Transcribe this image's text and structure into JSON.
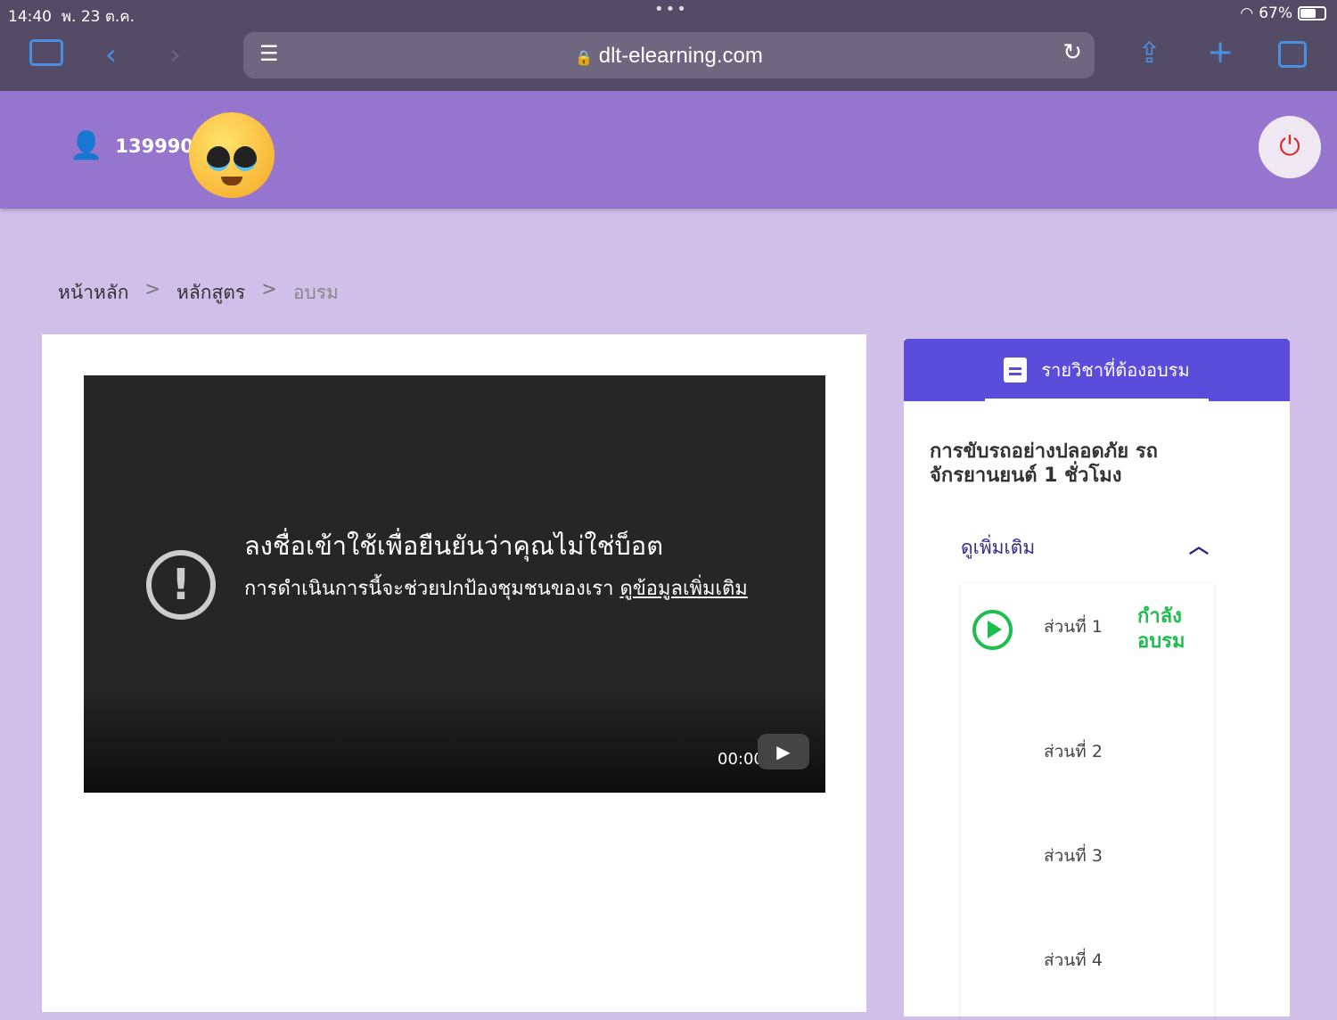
{
  "status_bar": {
    "time": "14:40",
    "date": "พ. 23 ต.ค.",
    "battery": "67%",
    "battery_level": 67
  },
  "browser": {
    "url": "dlt-elearning.com"
  },
  "header": {
    "user_id": "1399900"
  },
  "breadcrumb": {
    "items": [
      "หน้าหลัก",
      "หลักสูตร",
      "อบรม"
    ],
    "separator": ">"
  },
  "video": {
    "title": "ลงชื่อเข้าใช้เพื่อยืนยันว่าคุณไม่ใช่บ็อต",
    "subtitle": "การดำเนินการนี้จะช่วยปกป้องชุมชนของเรา",
    "link": "ดูข้อมูลเพิ่มเติม",
    "time": "00:00"
  },
  "sidebar": {
    "tab_label": "รายวิชาที่ต้องอบรม",
    "course_title": "การขับรถอย่างปลอดภัย รถจักรยานยนต์ 1 ชั่วโมง",
    "see_more": "ดูเพิ่มเติม",
    "parts": [
      {
        "label": "ส่วนที่ 1",
        "status": "กำลังอบรม"
      },
      {
        "label": "ส่วนที่ 2"
      },
      {
        "label": "ส่วนที่ 3"
      },
      {
        "label": "ส่วนที่ 4"
      }
    ],
    "accent": "#5b4ddc",
    "status_color": "#1ebe4e"
  }
}
